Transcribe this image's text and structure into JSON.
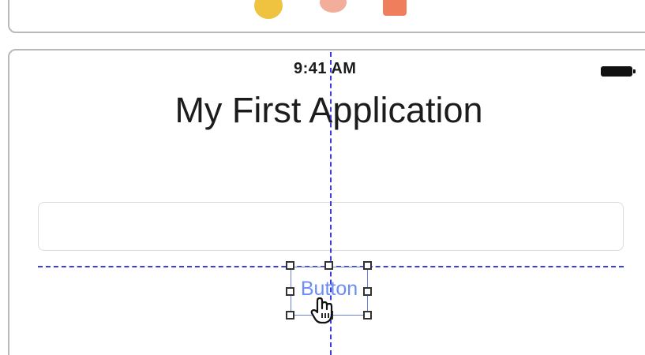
{
  "dock": {
    "icons": [
      {
        "name": "yellow-app-icon",
        "color": "#efc23f"
      },
      {
        "name": "orange-app-icon",
        "color": "#f0a08a"
      },
      {
        "name": "red-app-icon",
        "color": "#ef7f5c"
      }
    ]
  },
  "device": {
    "status_bar": {
      "time": "9:41 AM",
      "battery_icon": "battery-icon"
    },
    "title_label": "My First Application",
    "text_field": {
      "value": "",
      "placeholder": ""
    },
    "button": {
      "label": "Button",
      "color": "#6a8ef5"
    },
    "guides_color": "#3c3cd9",
    "cursor_icon": "hand-pointer-icon"
  }
}
